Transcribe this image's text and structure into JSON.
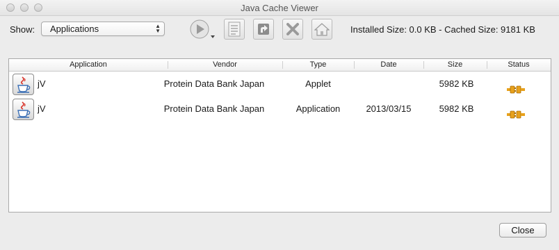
{
  "window": {
    "title": "Java Cache Viewer"
  },
  "toolbar": {
    "show_label": "Show:",
    "show_select_value": "Applications",
    "size_info": "Installed Size:  0.0 KB - Cached Size:  9181 KB",
    "buttons": [
      {
        "name": "run",
        "icon": "play-icon"
      },
      {
        "name": "show-jnlp",
        "icon": "document-list-icon"
      },
      {
        "name": "install-shortcuts",
        "icon": "launch-arrow-icon"
      },
      {
        "name": "delete",
        "icon": "delete-x-icon"
      },
      {
        "name": "homepage",
        "icon": "home-icon"
      }
    ]
  },
  "table": {
    "headers": [
      "Application",
      "Vendor",
      "Type",
      "Date",
      "Size",
      "Status"
    ],
    "rows": [
      {
        "icon": "java-cup-icon",
        "application": "jV",
        "vendor": "Protein Data Bank Japan",
        "type": "Applet",
        "date": "",
        "size": "5982 KB",
        "status": "plug-icon"
      },
      {
        "icon": "java-cup-icon",
        "application": "jV",
        "vendor": "Protein Data Bank Japan",
        "type": "Application",
        "date": "2013/03/15",
        "size": "5982 KB",
        "status": "plug-icon"
      }
    ]
  },
  "footer": {
    "close_label": "Close"
  },
  "colors": {
    "status_plug": "#e8a11c",
    "java_red": "#d9352b",
    "java_blue": "#3b6fb6"
  }
}
